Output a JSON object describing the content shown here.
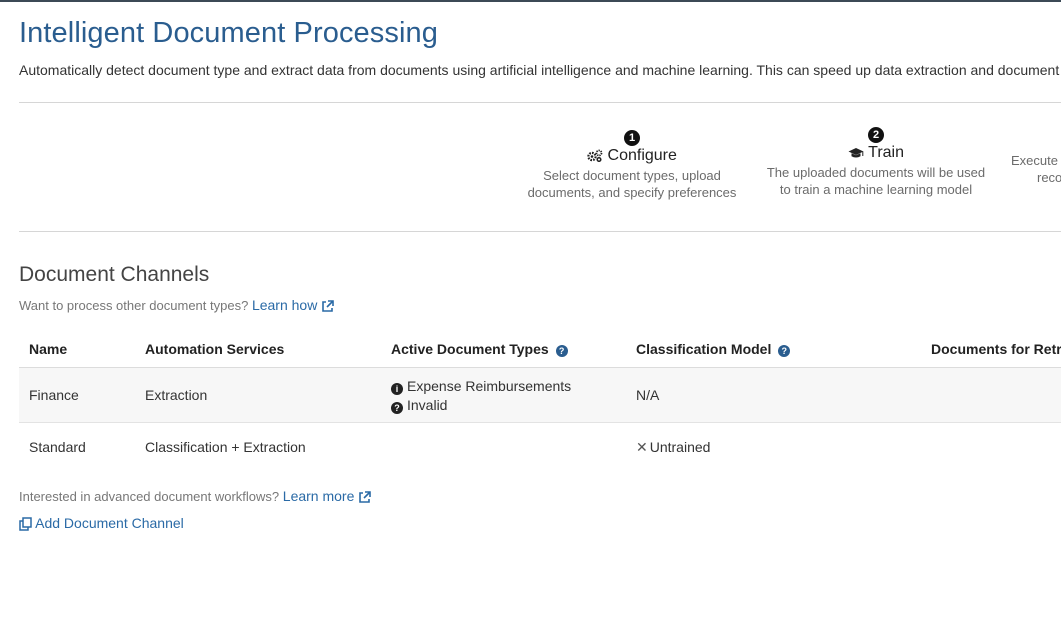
{
  "header": {
    "title": "Intelligent Document Processing",
    "subtitle": "Automatically detect document type and extract data from documents using artificial intelligence and machine learning. This can speed up data extraction and document filin"
  },
  "steps": [
    {
      "number": "1",
      "name": "Configure",
      "icon": "gears-icon",
      "desc_line1": "Select document types, upload",
      "desc_line2": "documents, and specify preferences"
    },
    {
      "number": "2",
      "name": "Train",
      "icon": "graduation-cap-icon",
      "desc_line1": "The uploaded documents will be used",
      "desc_line2": "to train a machine learning model"
    },
    {
      "desc_line1": "Execute c",
      "desc_line2": "reco"
    }
  ],
  "channels": {
    "heading": "Document Channels",
    "hint_text": "Want to process other document types?",
    "hint_link": "Learn how",
    "columns": [
      "Name",
      "Automation Services",
      "Active Document Types",
      "Classification Model",
      "Documents for Retra"
    ],
    "rows": [
      {
        "name": "Finance",
        "services": "Extraction",
        "doc_type_1": "Expense Reimbursements",
        "doc_type_2": "Invalid",
        "model": "N/A"
      },
      {
        "name": "Standard",
        "services": "Classification + Extraction",
        "model": "Untrained"
      }
    ],
    "footer_text": "Interested in advanced document workflows?",
    "footer_link": "Learn more",
    "add_link": "Add Document Channel"
  },
  "colors": {
    "title": "#2a5d8f",
    "link": "#2a6aa6",
    "accent_bar": "#3c4a56"
  }
}
